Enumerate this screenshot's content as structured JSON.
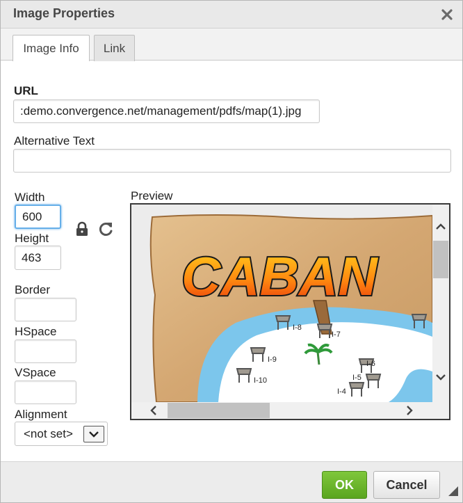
{
  "dialog": {
    "title": "Image Properties",
    "close_icon": "close-icon"
  },
  "tabs": [
    {
      "label": "Image Info",
      "active": true
    },
    {
      "label": "Link",
      "active": false
    }
  ],
  "form": {
    "url_label": "URL",
    "url_value": ":demo.convergence.net/management/pdfs/map(1).jpg",
    "alt_label": "Alternative Text",
    "alt_value": "",
    "width_label": "Width",
    "width_value": "600",
    "height_label": "Height",
    "height_value": "463",
    "lock_icon": "lock-icon",
    "reset_icon": "reset-size-icon",
    "border_label": "Border",
    "border_value": "",
    "hspace_label": "HSpace",
    "hspace_value": "",
    "vspace_label": "VSpace",
    "vspace_value": "",
    "alignment_label": "Alignment",
    "alignment_value": "<not set>"
  },
  "preview": {
    "label": "Preview",
    "image_text": "CABAN",
    "cabana_labels": [
      "I-8",
      "I-7",
      "I-9",
      "I-6",
      "I-10",
      "I-5",
      "I-4"
    ]
  },
  "footer": {
    "ok_label": "OK",
    "cancel_label": "Cancel"
  },
  "colors": {
    "ok_green": "#6bb62c",
    "focus_blue": "#66afe9",
    "water": "#7cc6ec",
    "parchment": "#d9b17c"
  }
}
